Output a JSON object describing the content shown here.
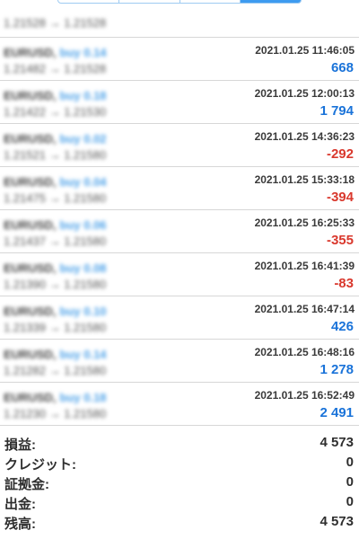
{
  "top_row": {
    "prices": "1.21528 → 1.21528"
  },
  "deals": [
    {
      "symbol": "EURUSD,",
      "side": "buy 0.14",
      "prices": "1.21482 → 1.21528",
      "datetime": "2021.01.25 11:46:05",
      "profit": "668",
      "sign": "pos"
    },
    {
      "symbol": "EURUSD,",
      "side": "buy 0.18",
      "prices": "1.21422 → 1.21530",
      "datetime": "2021.01.25 12:00:13",
      "profit": "1 794",
      "sign": "pos"
    },
    {
      "symbol": "EURUSD,",
      "side": "buy 0.02",
      "prices": "1.21521 → 1.21580",
      "datetime": "2021.01.25 14:36:23",
      "profit": "-292",
      "sign": "neg"
    },
    {
      "symbol": "EURUSD,",
      "side": "buy 0.04",
      "prices": "1.21475 → 1.21580",
      "datetime": "2021.01.25 15:33:18",
      "profit": "-394",
      "sign": "neg"
    },
    {
      "symbol": "EURUSD,",
      "side": "buy 0.06",
      "prices": "1.21437 → 1.21580",
      "datetime": "2021.01.25 16:25:33",
      "profit": "-355",
      "sign": "neg"
    },
    {
      "symbol": "EURUSD,",
      "side": "buy 0.08",
      "prices": "1.21390 → 1.21580",
      "datetime": "2021.01.25 16:41:39",
      "profit": "-83",
      "sign": "neg"
    },
    {
      "symbol": "EURUSD,",
      "side": "buy 0.10",
      "prices": "1.21339 → 1.21580",
      "datetime": "2021.01.25 16:47:14",
      "profit": "426",
      "sign": "pos"
    },
    {
      "symbol": "EURUSD,",
      "side": "buy 0.14",
      "prices": "1.21282 → 1.21580",
      "datetime": "2021.01.25 16:48:16",
      "profit": "1 278",
      "sign": "pos"
    },
    {
      "symbol": "EURUSD,",
      "side": "buy 0.18",
      "prices": "1.21230 → 1.21580",
      "datetime": "2021.01.25 16:52:49",
      "profit": "2 491",
      "sign": "pos"
    }
  ],
  "summary": [
    {
      "label": "損益:",
      "value": "4 573"
    },
    {
      "label": "クレジット:",
      "value": "0"
    },
    {
      "label": "証拠金:",
      "value": "0"
    },
    {
      "label": "出金:",
      "value": "0"
    },
    {
      "label": "残高:",
      "value": "4 573"
    }
  ],
  "colors": {
    "profit_positive": "#1a73d9",
    "profit_negative": "#d9382d",
    "side_label": "#4aa0e8",
    "active_tab": "#3d9bf0"
  }
}
